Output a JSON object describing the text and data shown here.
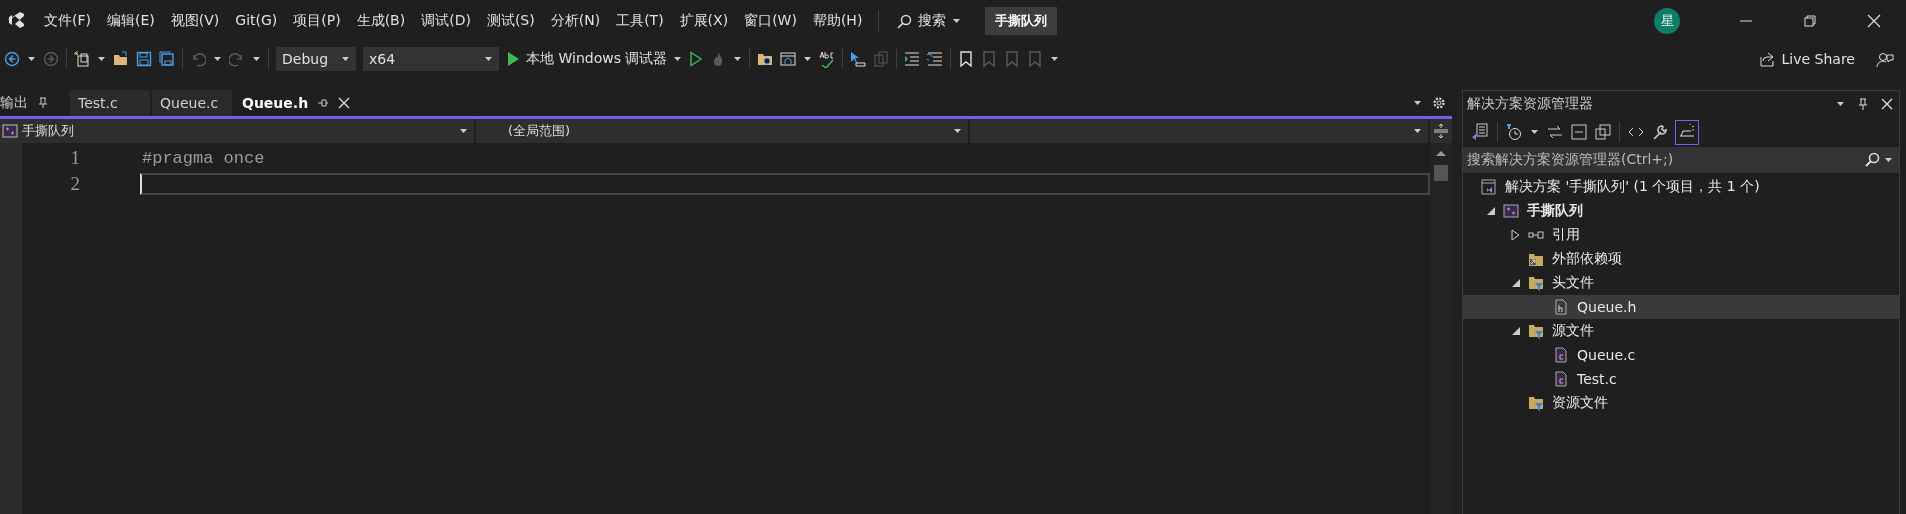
{
  "menu": [
    {
      "label": "文件(F)"
    },
    {
      "label": "编辑(E)"
    },
    {
      "label": "视图(V)"
    },
    {
      "label": "Git(G)"
    },
    {
      "label": "项目(P)"
    },
    {
      "label": "生成(B)"
    },
    {
      "label": "调试(D)"
    },
    {
      "label": "测试(S)"
    },
    {
      "label": "分析(N)"
    },
    {
      "label": "工具(T)"
    },
    {
      "label": "扩展(X)"
    },
    {
      "label": "窗口(W)"
    },
    {
      "label": "帮助(H)"
    }
  ],
  "search": {
    "label": "搜索"
  },
  "solution_badge": "手撕队列",
  "avatar": "星",
  "toolbar": {
    "configuration": "Debug",
    "platform": "x64",
    "run": "本地 Windows 调试器",
    "live_share": "Live Share"
  },
  "tabs": [
    {
      "label": "输出",
      "kind": "tool",
      "selected": false
    },
    {
      "label": "Test.c",
      "kind": "doc",
      "selected": false
    },
    {
      "label": "Queue.c",
      "kind": "doc",
      "selected": false
    },
    {
      "label": "Queue.h",
      "kind": "doc",
      "selected": true
    }
  ],
  "navbar": {
    "project": "手撕队列",
    "scope": "(全局范围)"
  },
  "code": [
    {
      "number": "1",
      "text": "#pragma once",
      "current": false
    },
    {
      "number": "2",
      "current": true
    }
  ],
  "solution_explorer": {
    "title": "解决方案资源管理器",
    "search_placeholder": "搜索解决方案资源管理器(Ctrl+;)",
    "tree": {
      "label": "解决方案 '手撕队列' (1 个项目，共 1 个)",
      "kind": "solution",
      "selected": false,
      "children": [
        {
          "label": "手撕队列",
          "kind": "project",
          "expanded": true,
          "selected": false,
          "children": [
            {
              "label": "引用",
              "kind": "references",
              "expanded": false,
              "selected": false
            },
            {
              "label": "外部依赖项",
              "kind": "external",
              "selected": false
            },
            {
              "label": "头文件",
              "kind": "filter",
              "expanded": true,
              "selected": false,
              "children": [
                {
                  "label": "Queue.h",
                  "kind": "header",
                  "selected": true
                }
              ]
            },
            {
              "label": "源文件",
              "kind": "filter",
              "expanded": true,
              "selected": false,
              "children": [
                {
                  "label": "Queue.c",
                  "kind": "source",
                  "selected": false
                },
                {
                  "label": "Test.c",
                  "kind": "source",
                  "selected": false
                }
              ]
            },
            {
              "label": "资源文件",
              "kind": "filter",
              "selected": false
            }
          ]
        }
      ]
    }
  }
}
